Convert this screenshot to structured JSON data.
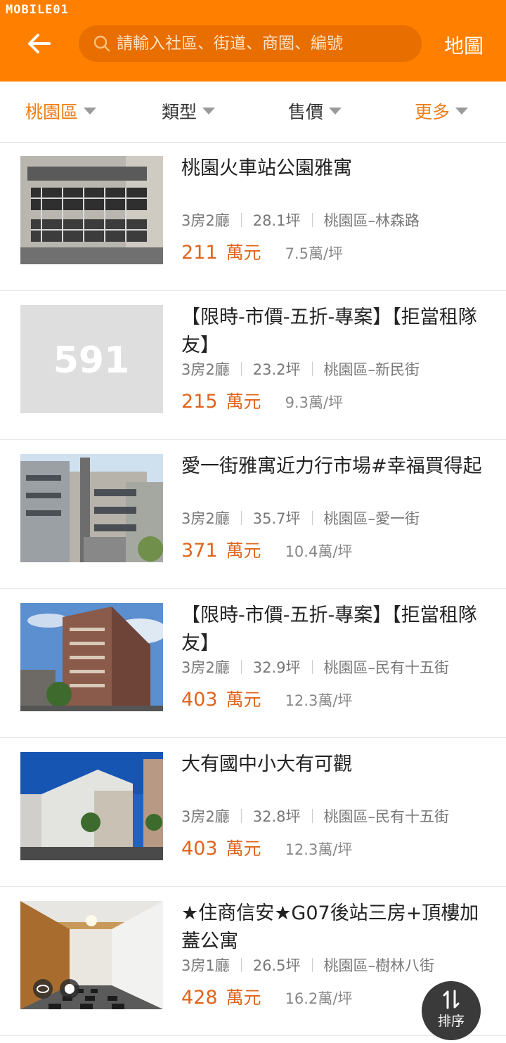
{
  "watermark": "MOBILE01",
  "header": {
    "search_placeholder": "請輸入社區、街道、商圈、編號",
    "map_label": "地圖"
  },
  "filters": [
    {
      "label": "桃園區",
      "active": true
    },
    {
      "label": "類型",
      "active": false
    },
    {
      "label": "售價",
      "active": false
    },
    {
      "label": "更多",
      "active": true
    }
  ],
  "listings": [
    {
      "title": "桃園火車站公園雅寓",
      "rooms": "3房2廳",
      "size": "28.1坪",
      "location": "桃園區–林森路",
      "price": "211",
      "price_unit": "萬元",
      "unit_price": "7.5萬/坪",
      "image": "apartment-facade"
    },
    {
      "title": "【限時-市價-五折-專案】【拒當租隊友】",
      "rooms": "3房2廳",
      "size": "23.2坪",
      "location": "桃園區–新民街",
      "price": "215",
      "price_unit": "萬元",
      "unit_price": "9.3萬/坪",
      "image": "placeholder",
      "placeholder_text": "591"
    },
    {
      "title": "愛一街雅寓近力行市場#幸福買得起",
      "rooms": "3房2廳",
      "size": "35.7坪",
      "location": "桃園區–愛一街",
      "price": "371",
      "price_unit": "萬元",
      "unit_price": "10.4萬/坪",
      "image": "apartment-street"
    },
    {
      "title": "【限時-市價-五折-專案】【拒當租隊友】",
      "rooms": "3房2廳",
      "size": "32.9坪",
      "location": "桃園區–民有十五街",
      "price": "403",
      "price_unit": "萬元",
      "unit_price": "12.3萬/坪",
      "image": "tower-building"
    },
    {
      "title": "大有國中小大有可觀",
      "rooms": "3房2廳",
      "size": "32.8坪",
      "location": "桃園區–民有十五街",
      "price": "403",
      "price_unit": "萬元",
      "unit_price": "12.3萬/坪",
      "image": "shopping-mall"
    },
    {
      "title": "★住商信安★G07後站三房+頂樓加蓋公寓",
      "rooms": "3房1廳",
      "size": "26.5坪",
      "location": "桃園區–樹林八街",
      "price": "428",
      "price_unit": "萬元",
      "unit_price": "16.2萬/坪",
      "image": "interior-hallway"
    }
  ],
  "sort_label": "排序",
  "colors": {
    "brand": "#ff8000",
    "price": "#e0641c",
    "active_filter": "#ef7d17"
  }
}
